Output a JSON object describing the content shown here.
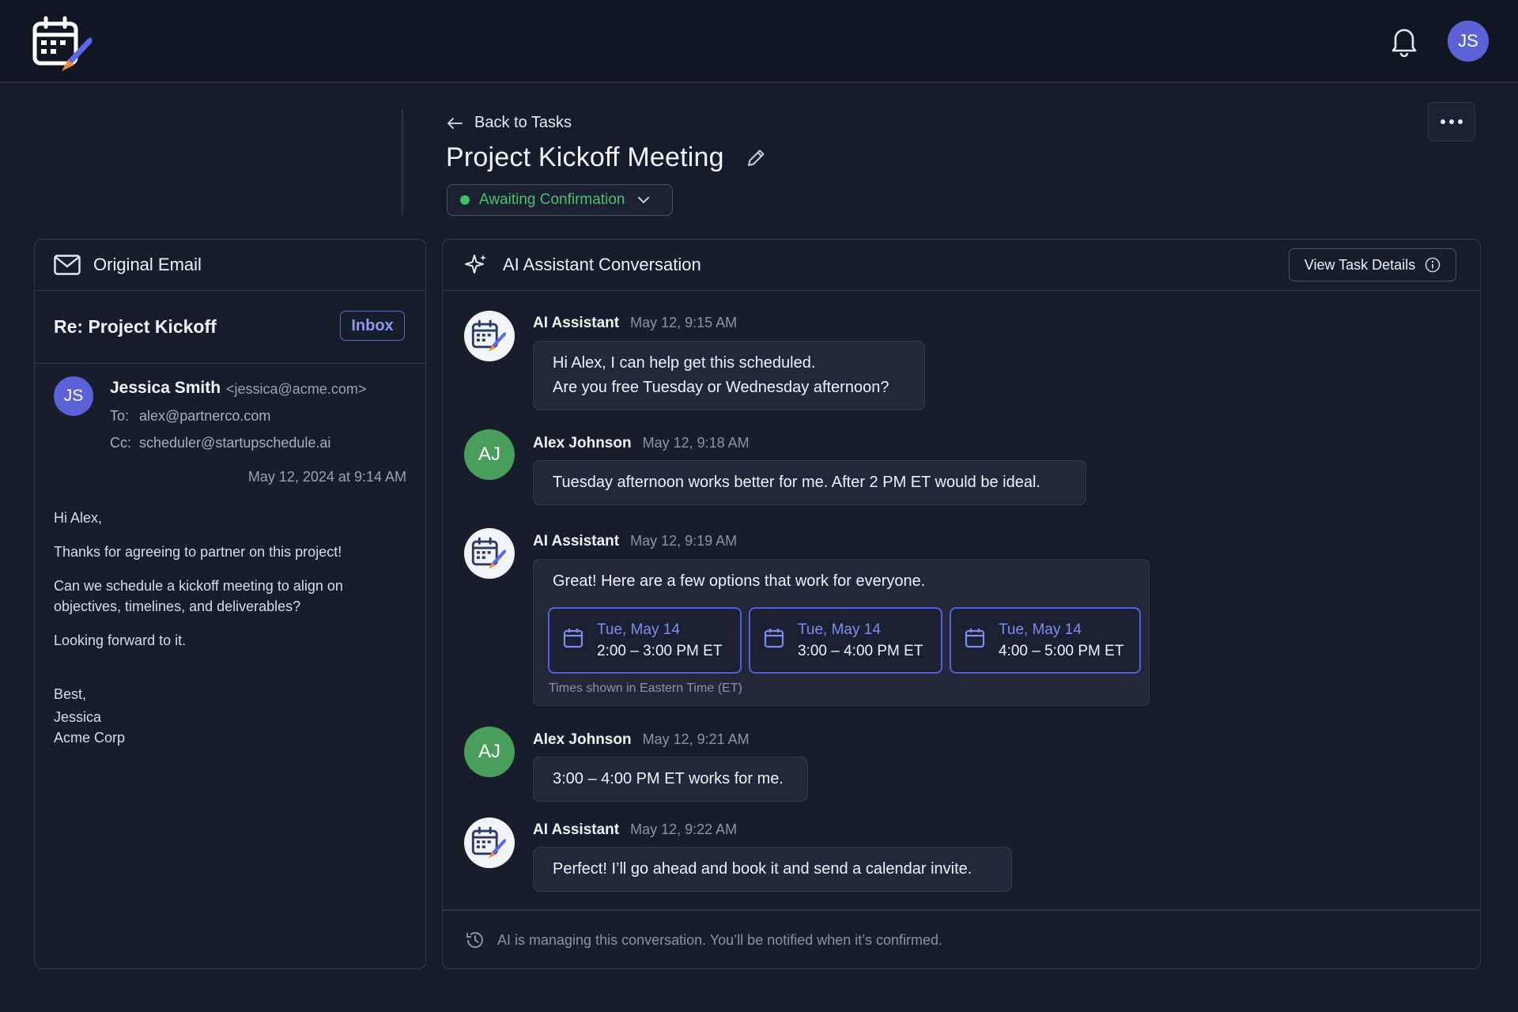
{
  "topbar": {
    "user_initials": "JS"
  },
  "header": {
    "back_label": "Back to Tasks",
    "title": "Project Kickoff Meeting",
    "status": "Awaiting Confirmation"
  },
  "email_panel": {
    "title": "Original Email",
    "subject": "Re: Project Kickoff",
    "folder_badge": "Inbox",
    "sender_initials": "JS",
    "sender_name": "Jessica Smith",
    "sender_email": "<jessica@acme.com>",
    "to_label": "To:",
    "to": "alex@partnerco.com",
    "cc_label": "Cc:",
    "cc": "scheduler@startupschedule.ai",
    "date": "May 12, 2024 at 9:14 AM",
    "body": {
      "greeting": "Hi Alex,",
      "p1": "Thanks for agreeing to partner on this project!",
      "p2_line1": "Can we schedule a kickoff meeting to align on",
      "p2_line2": "objectives, timelines, and deliverables?",
      "p3": "Looking forward to it.",
      "sign1": "Best,",
      "sign2": "Jessica",
      "sign3": "Acme Corp"
    }
  },
  "conversation": {
    "title": "AI Assistant Conversation",
    "view_details_label": "View Task Details",
    "messages": [
      {
        "sender": "AI Assistant",
        "time": "May 12, 9:15 AM",
        "line1": "Hi Alex, I can help get this scheduled.",
        "line2": "Are you free Tuesday or Wednesday afternoon?"
      },
      {
        "sender": "Alex Johnson",
        "initials": "AJ",
        "time": "May 12, 9:18 AM",
        "line1": "Tuesday afternoon works better for me. After 2 PM ET would be ideal."
      },
      {
        "sender": "AI Assistant",
        "time": "May 12, 9:19 AM",
        "line1": "Great! Here are a few options that work for everyone.",
        "note": "Times shown in Eastern Time (ET)"
      },
      {
        "sender": "Alex Johnson",
        "initials": "AJ",
        "time": "May 12, 9:21 AM",
        "line1": "3:00 – 4:00 PM ET works for me."
      },
      {
        "sender": "AI Assistant",
        "time": "May 12, 9:22 AM",
        "line1": "Perfect! I’ll go ahead and book it and send a calendar invite."
      }
    ],
    "slots": [
      {
        "date": "Tue, May 14",
        "time": "2:00 – 3:00 PM ET"
      },
      {
        "date": "Tue, May 14",
        "time": "3:00 – 4:00 PM ET"
      },
      {
        "date": "Tue, May 14",
        "time": "4:00 – 5:00 PM ET"
      }
    ],
    "footer": "AI is managing this conversation. You’ll be notified when it’s confirmed."
  },
  "colors": {
    "accent": "#5a62d6",
    "status_green": "#3fbf65",
    "slot_border": "#5361d6"
  },
  "icons": [
    "app-logo-icon",
    "bell-icon",
    "arrow-left-icon",
    "pencil-icon",
    "chevron-down-icon",
    "more-icon",
    "mail-icon",
    "sparkle-icon",
    "info-icon",
    "calendar-icon",
    "history-icon"
  ]
}
